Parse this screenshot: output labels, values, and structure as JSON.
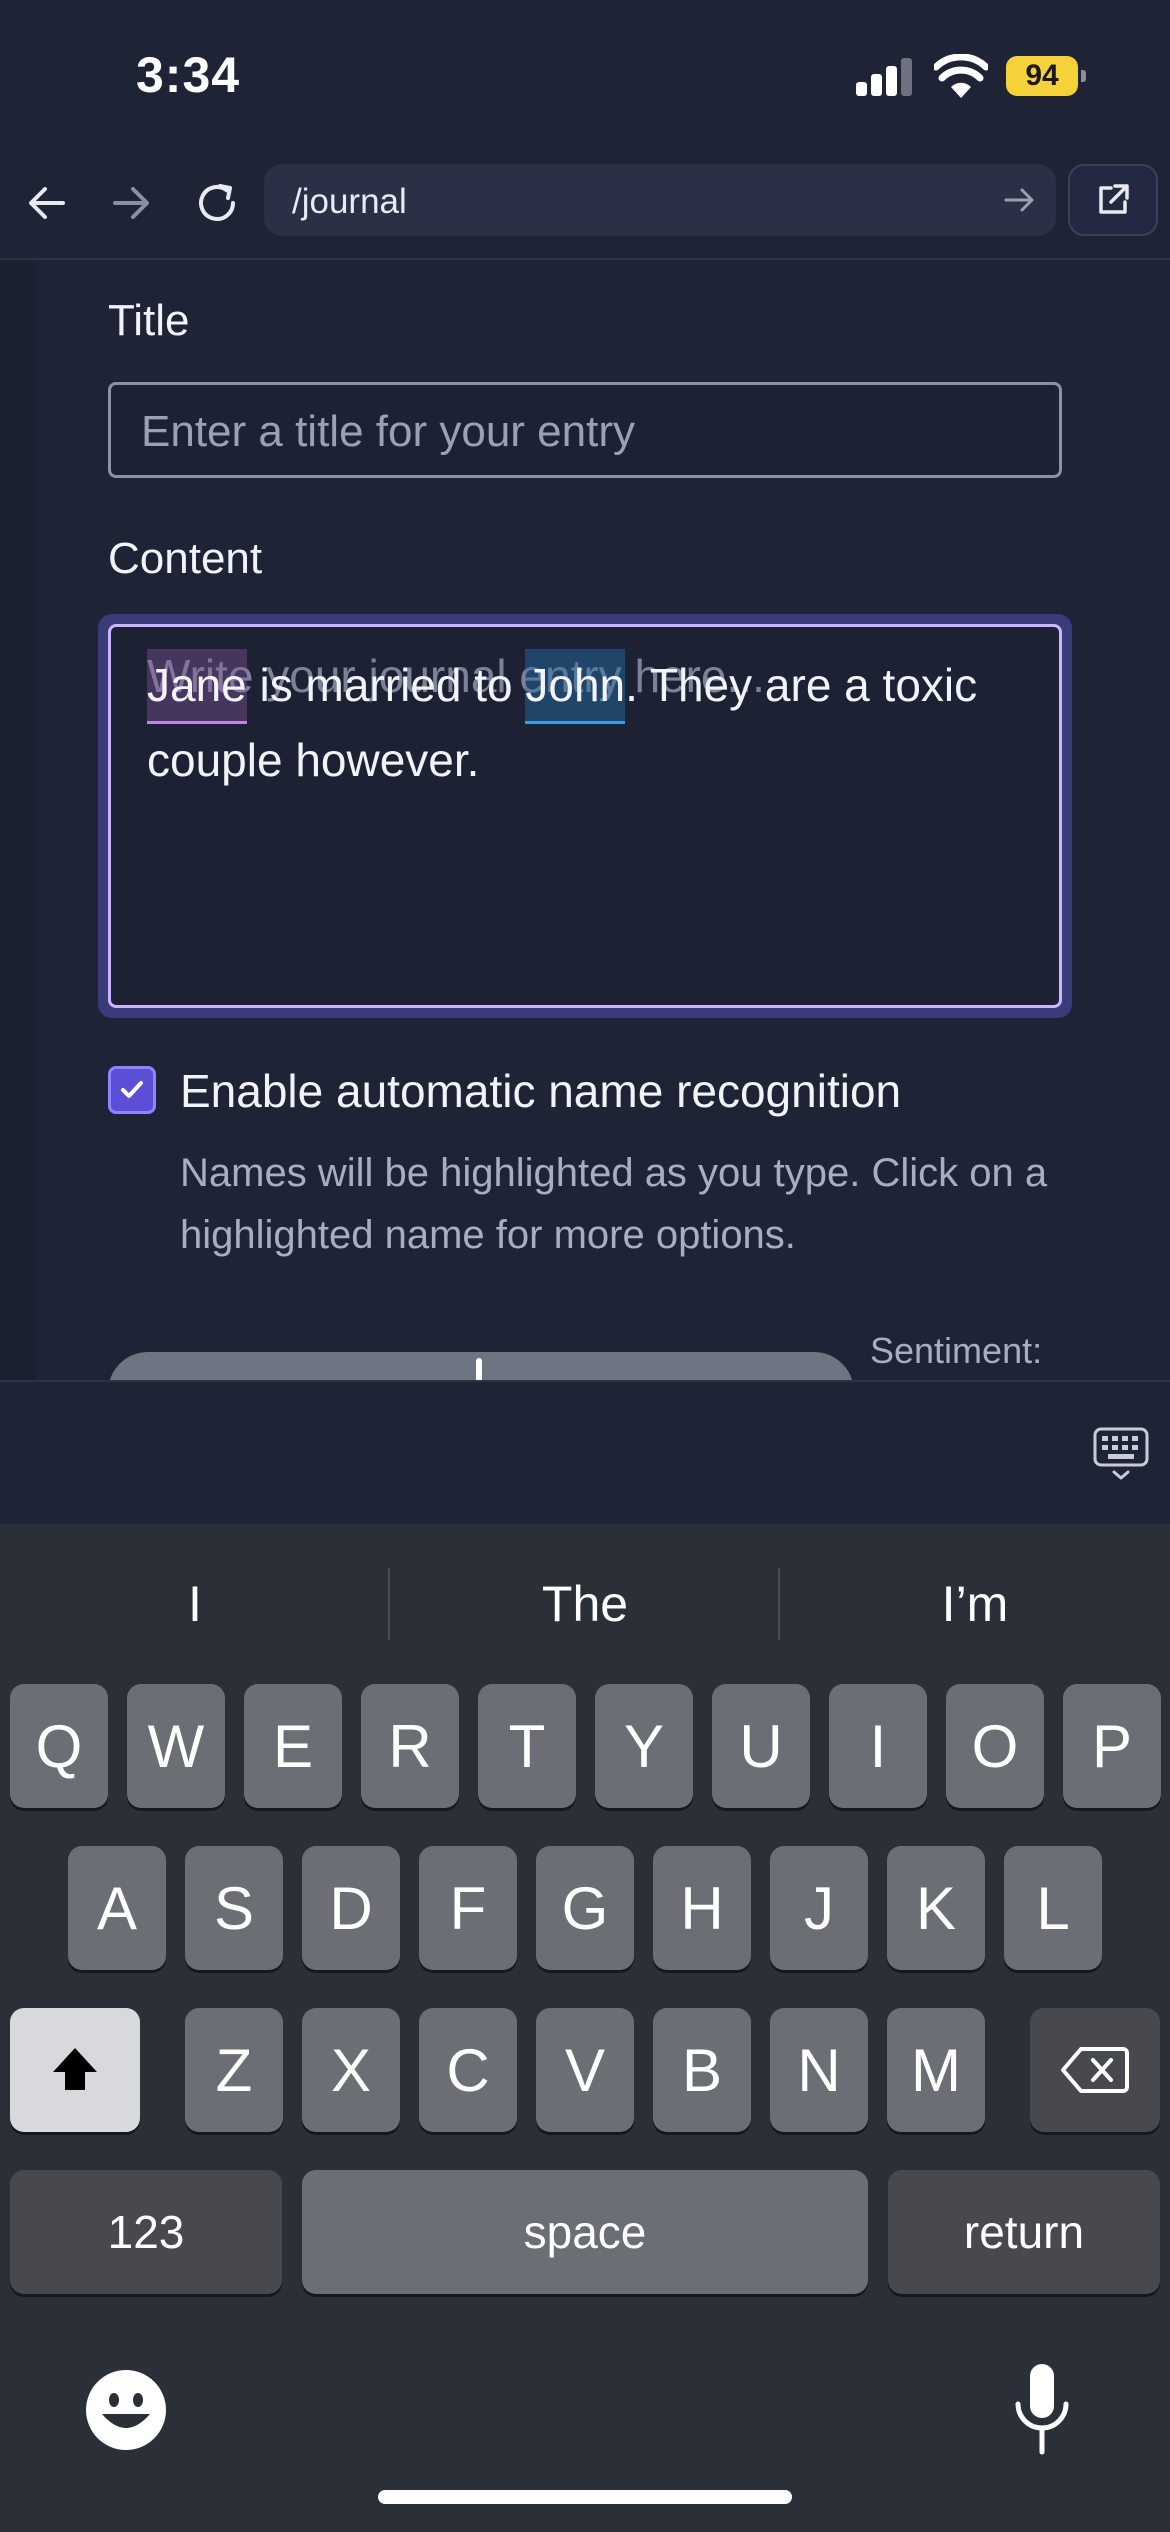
{
  "status_bar": {
    "time": "3:34",
    "battery": "94"
  },
  "browser": {
    "url": "/journal"
  },
  "form": {
    "title_label": "Title",
    "title_placeholder": "Enter a title for your entry",
    "content_label": "Content",
    "content_placeholder": "Write your journal entry here...",
    "content_value": {
      "name_1": "Jane",
      "text_1": " is married to ",
      "name_2": "John",
      "text_2": ". They are a toxic couple however."
    },
    "name_recognition_checked": true,
    "name_recognition_label": "Enable automatic name recognition",
    "name_recognition_hint": "Names will be highlighted as you type. Click on a highlighted name for more options.",
    "sentiment_label": "Sentiment:"
  },
  "keyboard": {
    "suggestions": [
      "I",
      "The",
      "I’m"
    ],
    "row1": [
      "Q",
      "W",
      "E",
      "R",
      "T",
      "Y",
      "U",
      "I",
      "O",
      "P"
    ],
    "row2": [
      "A",
      "S",
      "D",
      "F",
      "G",
      "H",
      "J",
      "K",
      "L"
    ],
    "row3": [
      "Z",
      "X",
      "C",
      "V",
      "B",
      "N",
      "M"
    ],
    "numbers_key": "123",
    "space_key": "space",
    "return_key": "return"
  },
  "colors": {
    "background": "#1e2435",
    "focus_ring": "#c9b6ff",
    "checkbox": "#5b4fd8",
    "name_highlight_purple": "#c184e6",
    "name_highlight_blue": "#3b9be6",
    "battery": "#f5d13a"
  }
}
